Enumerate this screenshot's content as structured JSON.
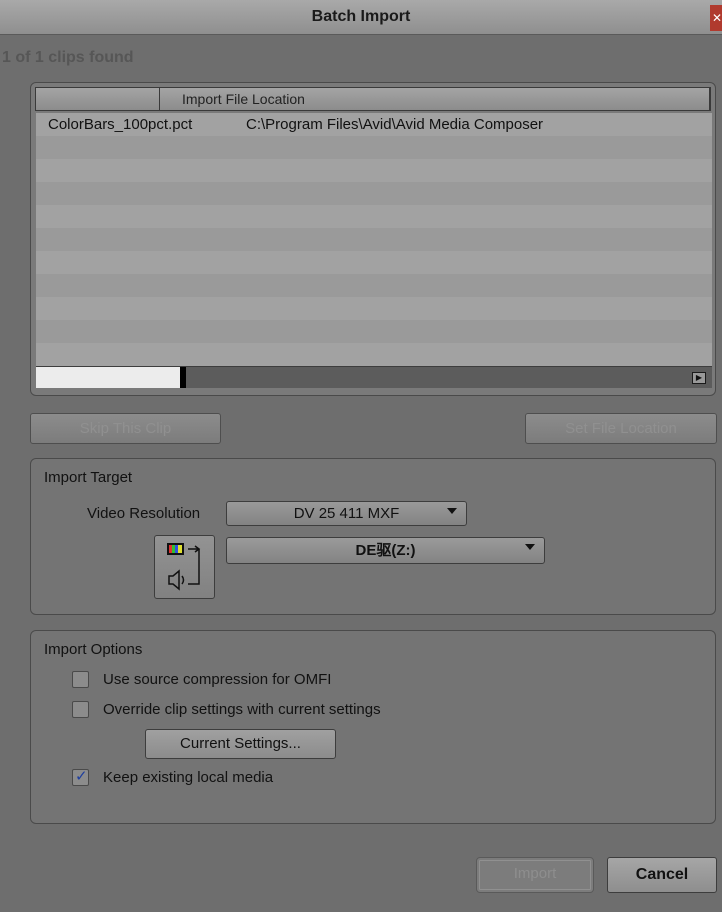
{
  "window": {
    "title": "Batch Import",
    "close_icon": "close-icon"
  },
  "status": {
    "clips_found": "1 of 1 clips found"
  },
  "clip_list": {
    "columns": [
      "",
      "Import File Location"
    ],
    "rows": [
      {
        "name": "ColorBars_100pct.pct",
        "location": "C:\\Program Files\\Avid\\Avid Media Composer"
      }
    ],
    "scroll_arrow_icon": "scroll-right-arrow-icon"
  },
  "buttons": {
    "skip_clip": "Skip This Clip",
    "set_file_location": "Set File Location",
    "current_settings": "Current Settings...",
    "import": "Import",
    "cancel": "Cancel"
  },
  "import_target": {
    "group_label": "Import Target",
    "video_resolution_label": "Video Resolution",
    "video_resolution_value": "DV 25 411  MXF",
    "drive_value": "DE驱(Z:)",
    "track_icon": "video-audio-track-icon"
  },
  "import_options": {
    "group_label": "Import Options",
    "options": [
      {
        "label": "Use source compression for OMFI",
        "checked": false
      },
      {
        "label": "Override clip settings with current settings",
        "checked": false
      },
      {
        "label": "Keep existing local media",
        "checked": true
      }
    ]
  }
}
